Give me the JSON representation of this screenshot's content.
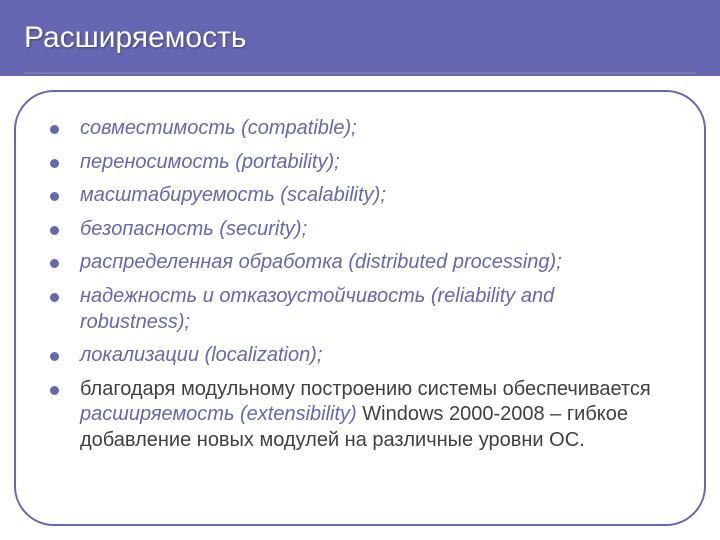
{
  "title": "Расширяемость",
  "bullets": {
    "b1": "совместимость (compatible);",
    "b2": "переносимость (portability);",
    "b3": "масштабируемость (scalability);",
    "b4": "безопасность (security);",
    "b5": "распределенная обработка (distributed processing);",
    "b6": "надежность и отказоустойчивость (reliability and robustness);",
    "b7": "локализации (localization);",
    "b8_pre": "благодаря модульному построению системы обеспечивается ",
    "b8_accent": "расширяемость (extensibility)",
    "b8_post": " Windows 2000-2008 – гибкое добавление новых модулей на различные уровни ОС."
  }
}
